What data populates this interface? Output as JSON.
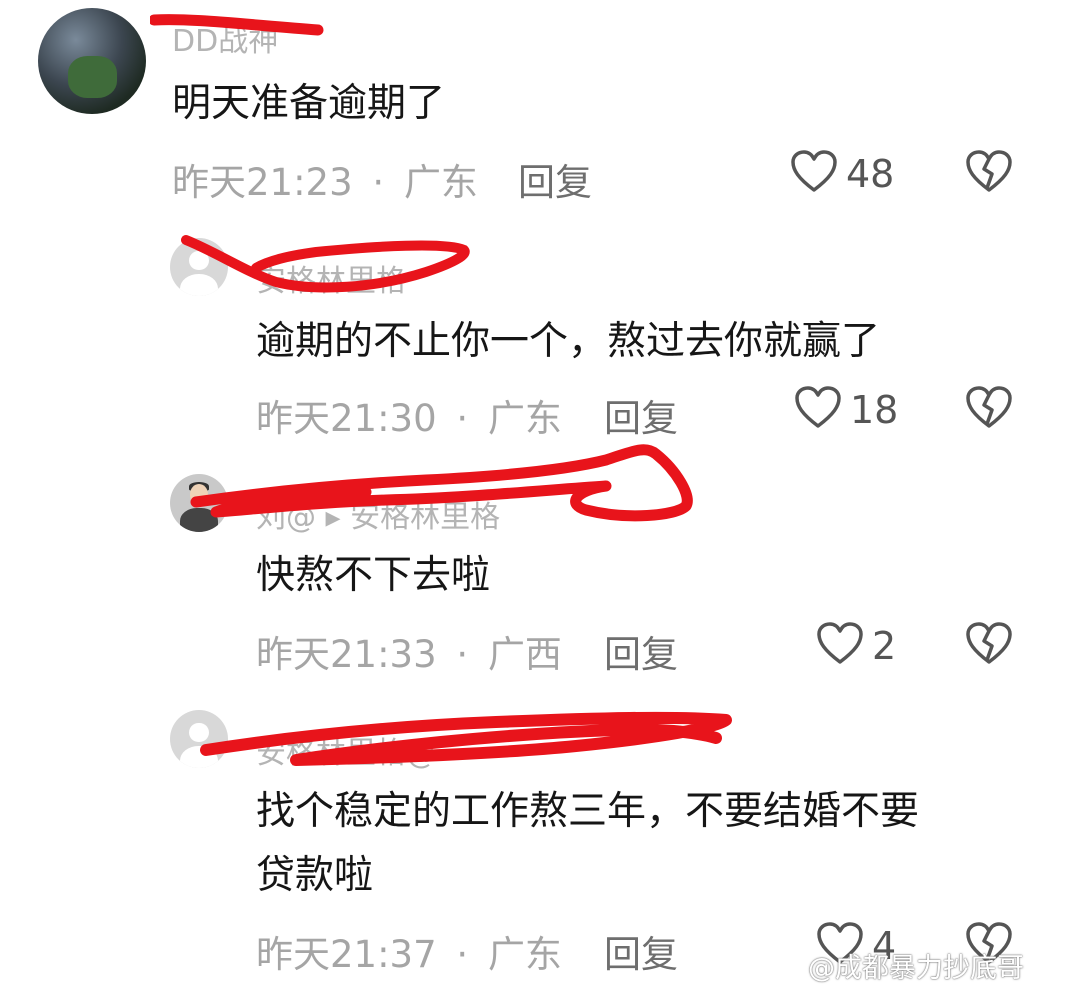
{
  "comments": [
    {
      "username": "DD战神",
      "text": "明天准备逾期了",
      "time": "昨天21:23",
      "sep": "·",
      "location": "广东",
      "reply_label": "回复",
      "likes": "48"
    },
    {
      "username": "安格林里格",
      "text": "逾期的不止你一个，熬过去你就赢了",
      "time": "昨天21:30",
      "sep": "·",
      "location": "广东",
      "reply_label": "回复",
      "likes": "18"
    },
    {
      "username": "刘@ ▸ 安格林里格",
      "text": "快熬不下去啦",
      "time": "昨天21:33",
      "sep": "·",
      "location": "广西",
      "reply_label": "回复",
      "likes": "2"
    },
    {
      "username": "安格林里格@",
      "text_line1": "找个稳定的工作熬三年，不要结婚不要",
      "text_line2": "贷款啦",
      "time": "昨天21:37",
      "sep": "·",
      "location": "广东",
      "reply_label": "回复",
      "likes": "4"
    }
  ],
  "icons": {
    "like": "heart-outline-icon",
    "dislike": "broken-heart-icon"
  },
  "colors": {
    "redaction": "#e8141b",
    "text": "#161616",
    "meta": "#a5a5a5"
  },
  "watermark": "@成都暴力抄底哥"
}
